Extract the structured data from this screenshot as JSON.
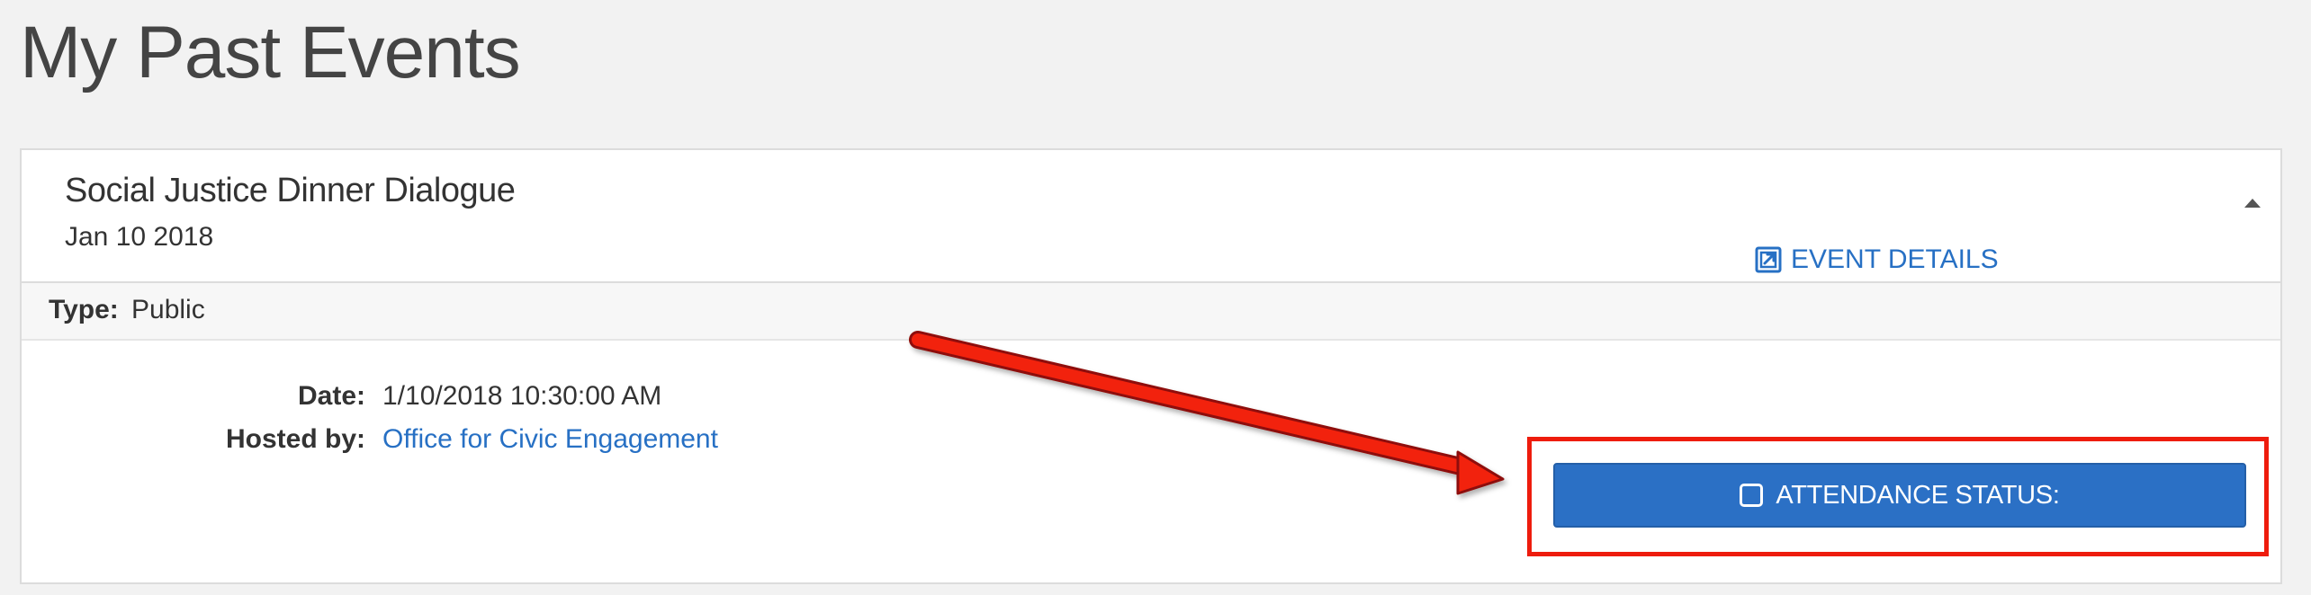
{
  "page": {
    "title": "My Past Events"
  },
  "event": {
    "name": "Social Justice Dinner Dialogue",
    "date_short": "Jan 10 2018",
    "type_label": "Type:",
    "type_value": "Public",
    "date_label": "Date:",
    "date_value": "1/10/2018 10:30:00 AM",
    "hosted_by_label": "Hosted by:",
    "hosted_by_value": "Office for Civic Engagement",
    "event_details_label": "EVENT DETAILS",
    "attendance_button_label": "ATTENDANCE STATUS:"
  },
  "icons": {
    "collapse": "caret-up-icon",
    "event_details": "external-link-icon",
    "attendance": "checkbox-icon"
  },
  "colors": {
    "link": "#2770c4",
    "button": "#2b70c5",
    "annotation": "#ee1c0d"
  }
}
